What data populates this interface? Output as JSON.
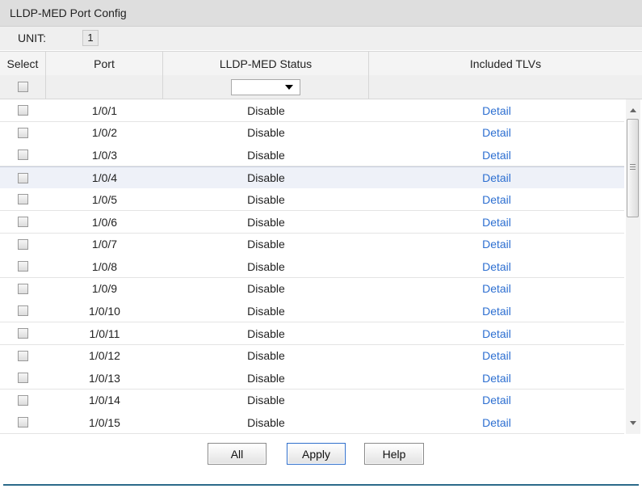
{
  "panel": {
    "title": "LLDP-MED Port Config"
  },
  "unit": {
    "label": "UNIT:",
    "value": "1"
  },
  "table": {
    "headers": {
      "select": "Select",
      "port": "Port",
      "status": "LLDP-MED Status",
      "tlvs": "Included TLVs"
    },
    "status_filter_value": "",
    "rows": [
      {
        "port": "1/0/1",
        "status": "Disable",
        "tlvs": "Detail"
      },
      {
        "port": "1/0/2",
        "status": "Disable",
        "tlvs": "Detail"
      },
      {
        "port": "1/0/3",
        "status": "Disable",
        "tlvs": "Detail"
      },
      {
        "port": "1/0/4",
        "status": "Disable",
        "tlvs": "Detail"
      },
      {
        "port": "1/0/5",
        "status": "Disable",
        "tlvs": "Detail"
      },
      {
        "port": "1/0/6",
        "status": "Disable",
        "tlvs": "Detail"
      },
      {
        "port": "1/0/7",
        "status": "Disable",
        "tlvs": "Detail"
      },
      {
        "port": "1/0/8",
        "status": "Disable",
        "tlvs": "Detail"
      },
      {
        "port": "1/0/9",
        "status": "Disable",
        "tlvs": "Detail"
      },
      {
        "port": "1/0/10",
        "status": "Disable",
        "tlvs": "Detail"
      },
      {
        "port": "1/0/11",
        "status": "Disable",
        "tlvs": "Detail"
      },
      {
        "port": "1/0/12",
        "status": "Disable",
        "tlvs": "Detail"
      },
      {
        "port": "1/0/13",
        "status": "Disable",
        "tlvs": "Detail"
      },
      {
        "port": "1/0/14",
        "status": "Disable",
        "tlvs": "Detail"
      },
      {
        "port": "1/0/15",
        "status": "Disable",
        "tlvs": "Detail"
      }
    ]
  },
  "buttons": {
    "all": "All",
    "apply": "Apply",
    "help": "Help"
  },
  "colors": {
    "link": "#2d6fd1",
    "accent_line": "#2b6a8a",
    "title_bg": "#dedede"
  }
}
